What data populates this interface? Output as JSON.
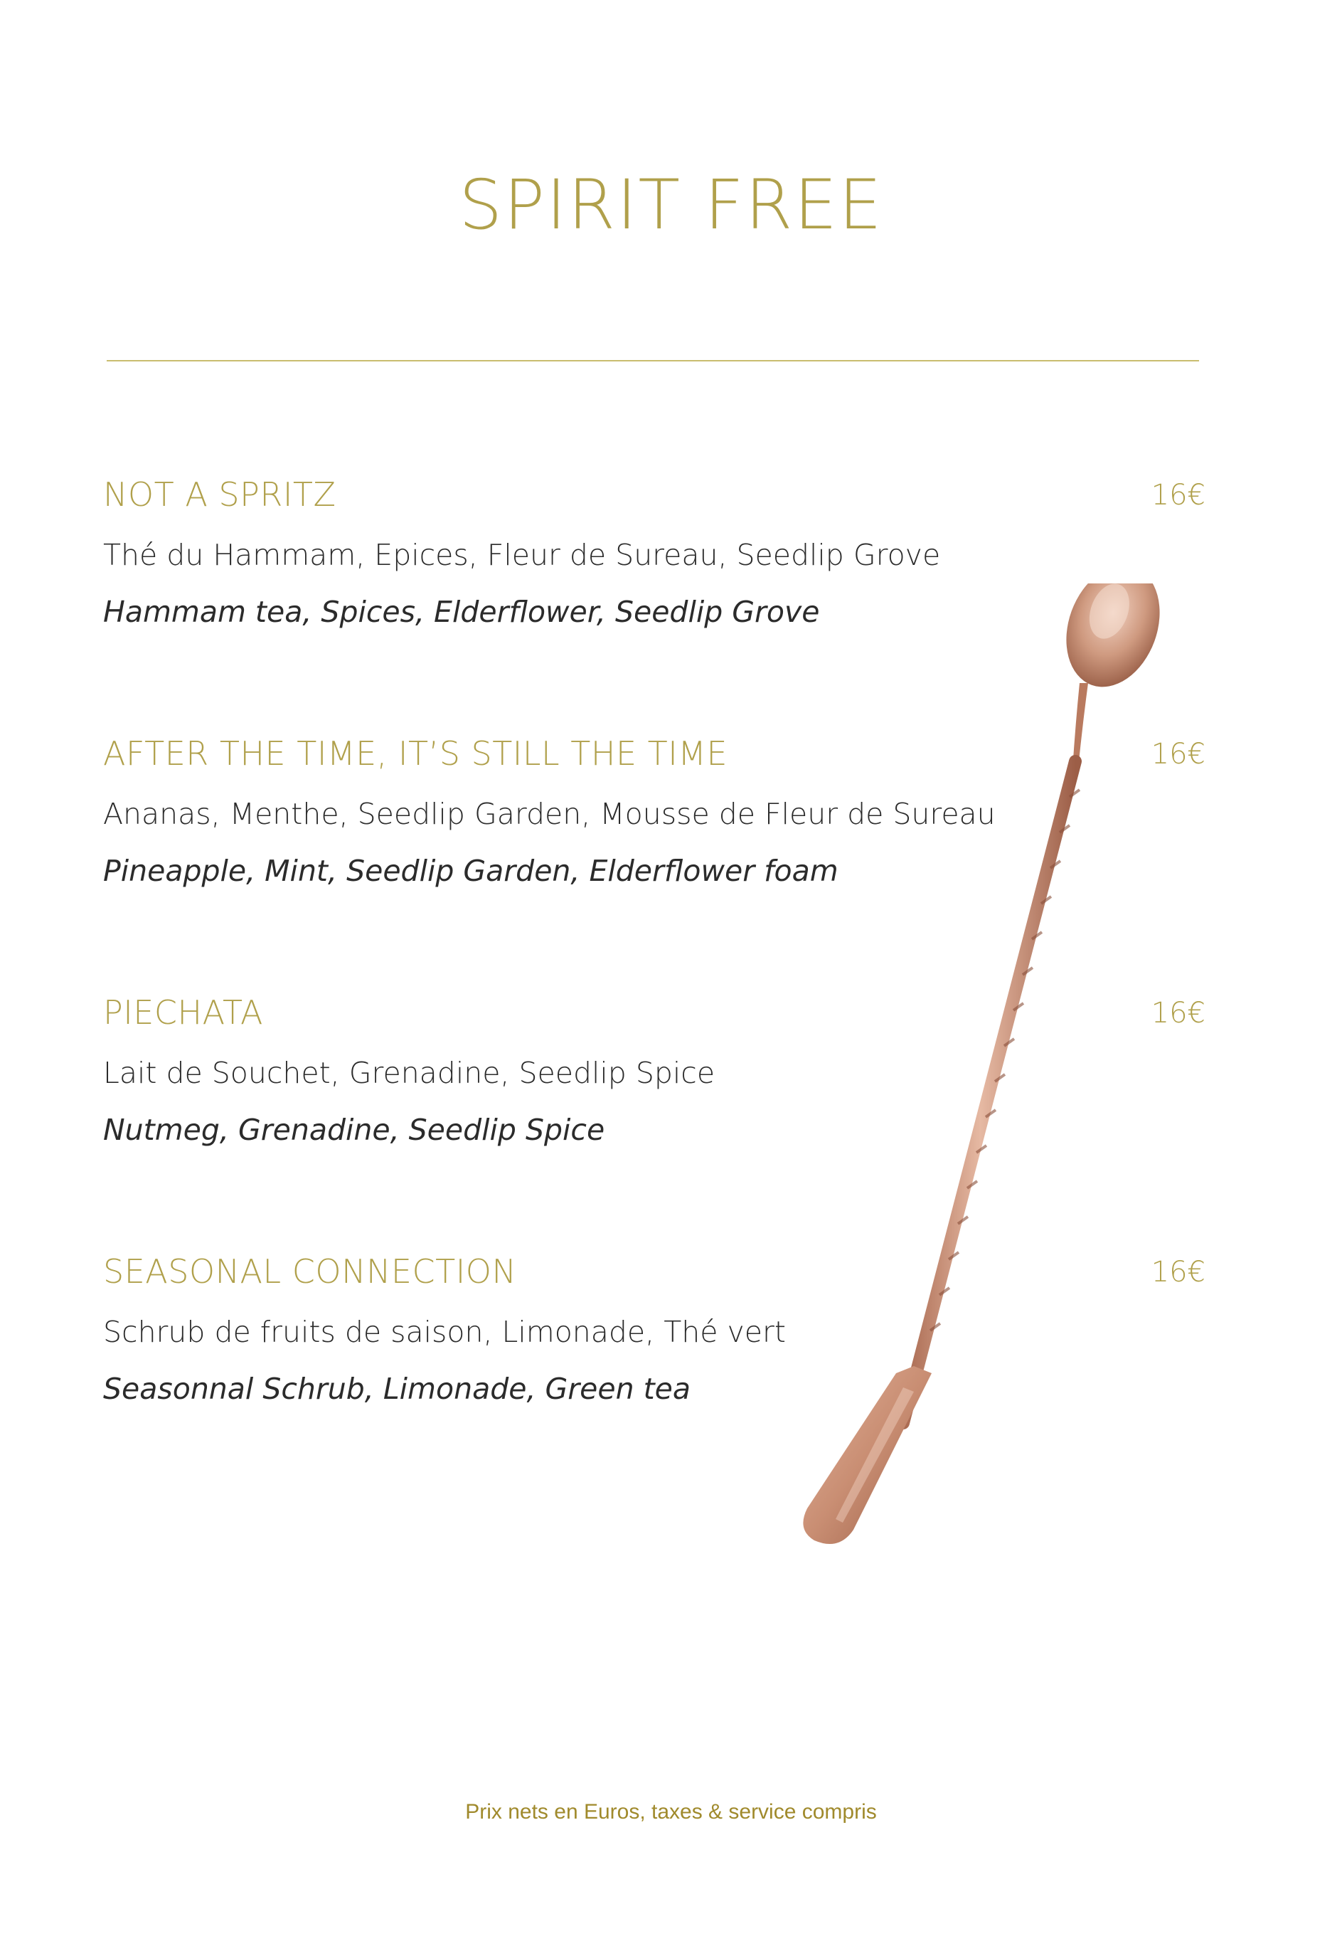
{
  "header": {
    "title": "SPIRIT FREE"
  },
  "items": [
    {
      "name": "NOT A SPRITZ",
      "price": "16€",
      "fr": "Thé du Hammam, Epices, Fleur de Sureau, Seedlip Grove",
      "en": "Hammam tea, Spices, Elderflower, Seedlip Grove"
    },
    {
      "name": "AFTER THE TIME, IT’S STILL THE TIME",
      "price": "16€",
      "fr": "Ananas, Menthe, Seedlip Garden, Mousse de Fleur de Sureau",
      "en": "Pineapple, Mint, Seedlip Garden, Elderflower foam"
    },
    {
      "name": "PIECHATA",
      "price": "16€",
      "fr": "Lait de Souchet, Grenadine, Seedlip Spice",
      "en": "Nutmeg, Grenadine, Seedlip Spice"
    },
    {
      "name": "SEASONAL CONNECTION",
      "price": "16€",
      "fr": "Schrub de fruits de saison, Limonade, Thé vert",
      "en": "Seasonnal Schrub, Limonade, Green tea"
    }
  ],
  "footer": {
    "note": "Prix nets en Euros, taxes & service compris"
  },
  "colors": {
    "accent_gold": "#b0a04b",
    "body_text": "#2b2b2b",
    "footer_text": "#a08a2c",
    "spoon_copper": "#c98e73"
  },
  "illustration": {
    "icon": "bar-spoon-icon"
  }
}
